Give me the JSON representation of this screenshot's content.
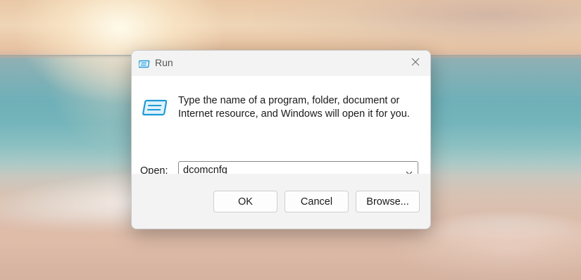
{
  "dialog": {
    "title": "Run",
    "title_icon": "run-icon",
    "close_icon": "close-icon",
    "description_line1": "Type the name of a program, folder, document or",
    "description_line2": "Internet resource, and Windows will open it for you.",
    "open_label": "Open:",
    "open_value": "dcomcnfg",
    "dropdown_icon": "chevron-down-icon",
    "buttons": {
      "ok": "OK",
      "cancel": "Cancel",
      "browse": "Browse..."
    }
  },
  "colors": {
    "dialog_bg": "#f3f3f3",
    "content_bg": "#ffffff",
    "icon_accent": "#1e9bd7"
  }
}
